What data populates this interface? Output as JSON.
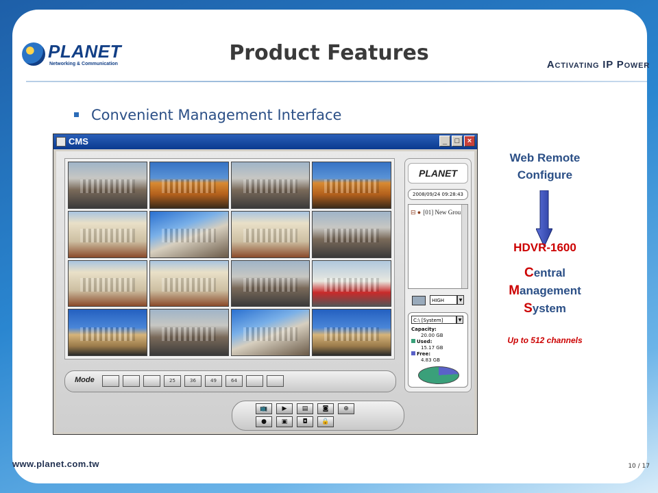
{
  "slide": {
    "title": "Product Features",
    "tagline": "Activating IP Power",
    "bullet": "Convenient Management Interface",
    "url": "www.planet.com.tw",
    "page": "10 / 17"
  },
  "logo": {
    "name": "PLANET",
    "sub": "Networking & Communication"
  },
  "annotations": {
    "web_remote": "Web Remote Configure",
    "hdvr": "HDVR-1600",
    "cms_initials": [
      "C",
      "M",
      "S"
    ],
    "cms_rest": [
      "entral",
      "anagement",
      "ystem"
    ],
    "channels": "Up to 512 channels"
  },
  "cms_window": {
    "title": "CMS",
    "window_buttons": [
      "_",
      "□",
      "×"
    ],
    "cameras": [
      "street",
      "opera",
      "street",
      "opera",
      "hotel",
      "avenue",
      "hotel",
      "street",
      "hotel",
      "hotel",
      "street",
      "bus",
      "palace",
      "street",
      "avenue",
      "palace"
    ],
    "mode_label": "Mode",
    "mode_buttons": [
      "",
      "",
      "",
      "25",
      "36",
      "49",
      "64",
      "",
      ""
    ],
    "control_buttons": [
      "tv-icon",
      "play-icon",
      "film-icon",
      "camera-icon",
      "globe-icon",
      "record-icon",
      "snapshot-icon",
      "camera-settings-icon",
      "lock-icon"
    ],
    "sidebar": {
      "logo": "PLANET",
      "clock": "2008/09/24 09:28:43",
      "tree_node": "[01] New Grou",
      "quality": "HIGH",
      "disk_select": "C:\\ [System]",
      "capacity_label": "Capacity:",
      "capacity_value": "20.00 GB",
      "used_label": "Used:",
      "used_value": "15.17 GB",
      "free_label": "Free:",
      "free_value": "4.83 GB",
      "used_color": "#3aa07a",
      "free_color": "#5a62c8"
    }
  },
  "colors": {
    "accent_blue": "#2b4f86",
    "accent_red": "#cc0000"
  }
}
